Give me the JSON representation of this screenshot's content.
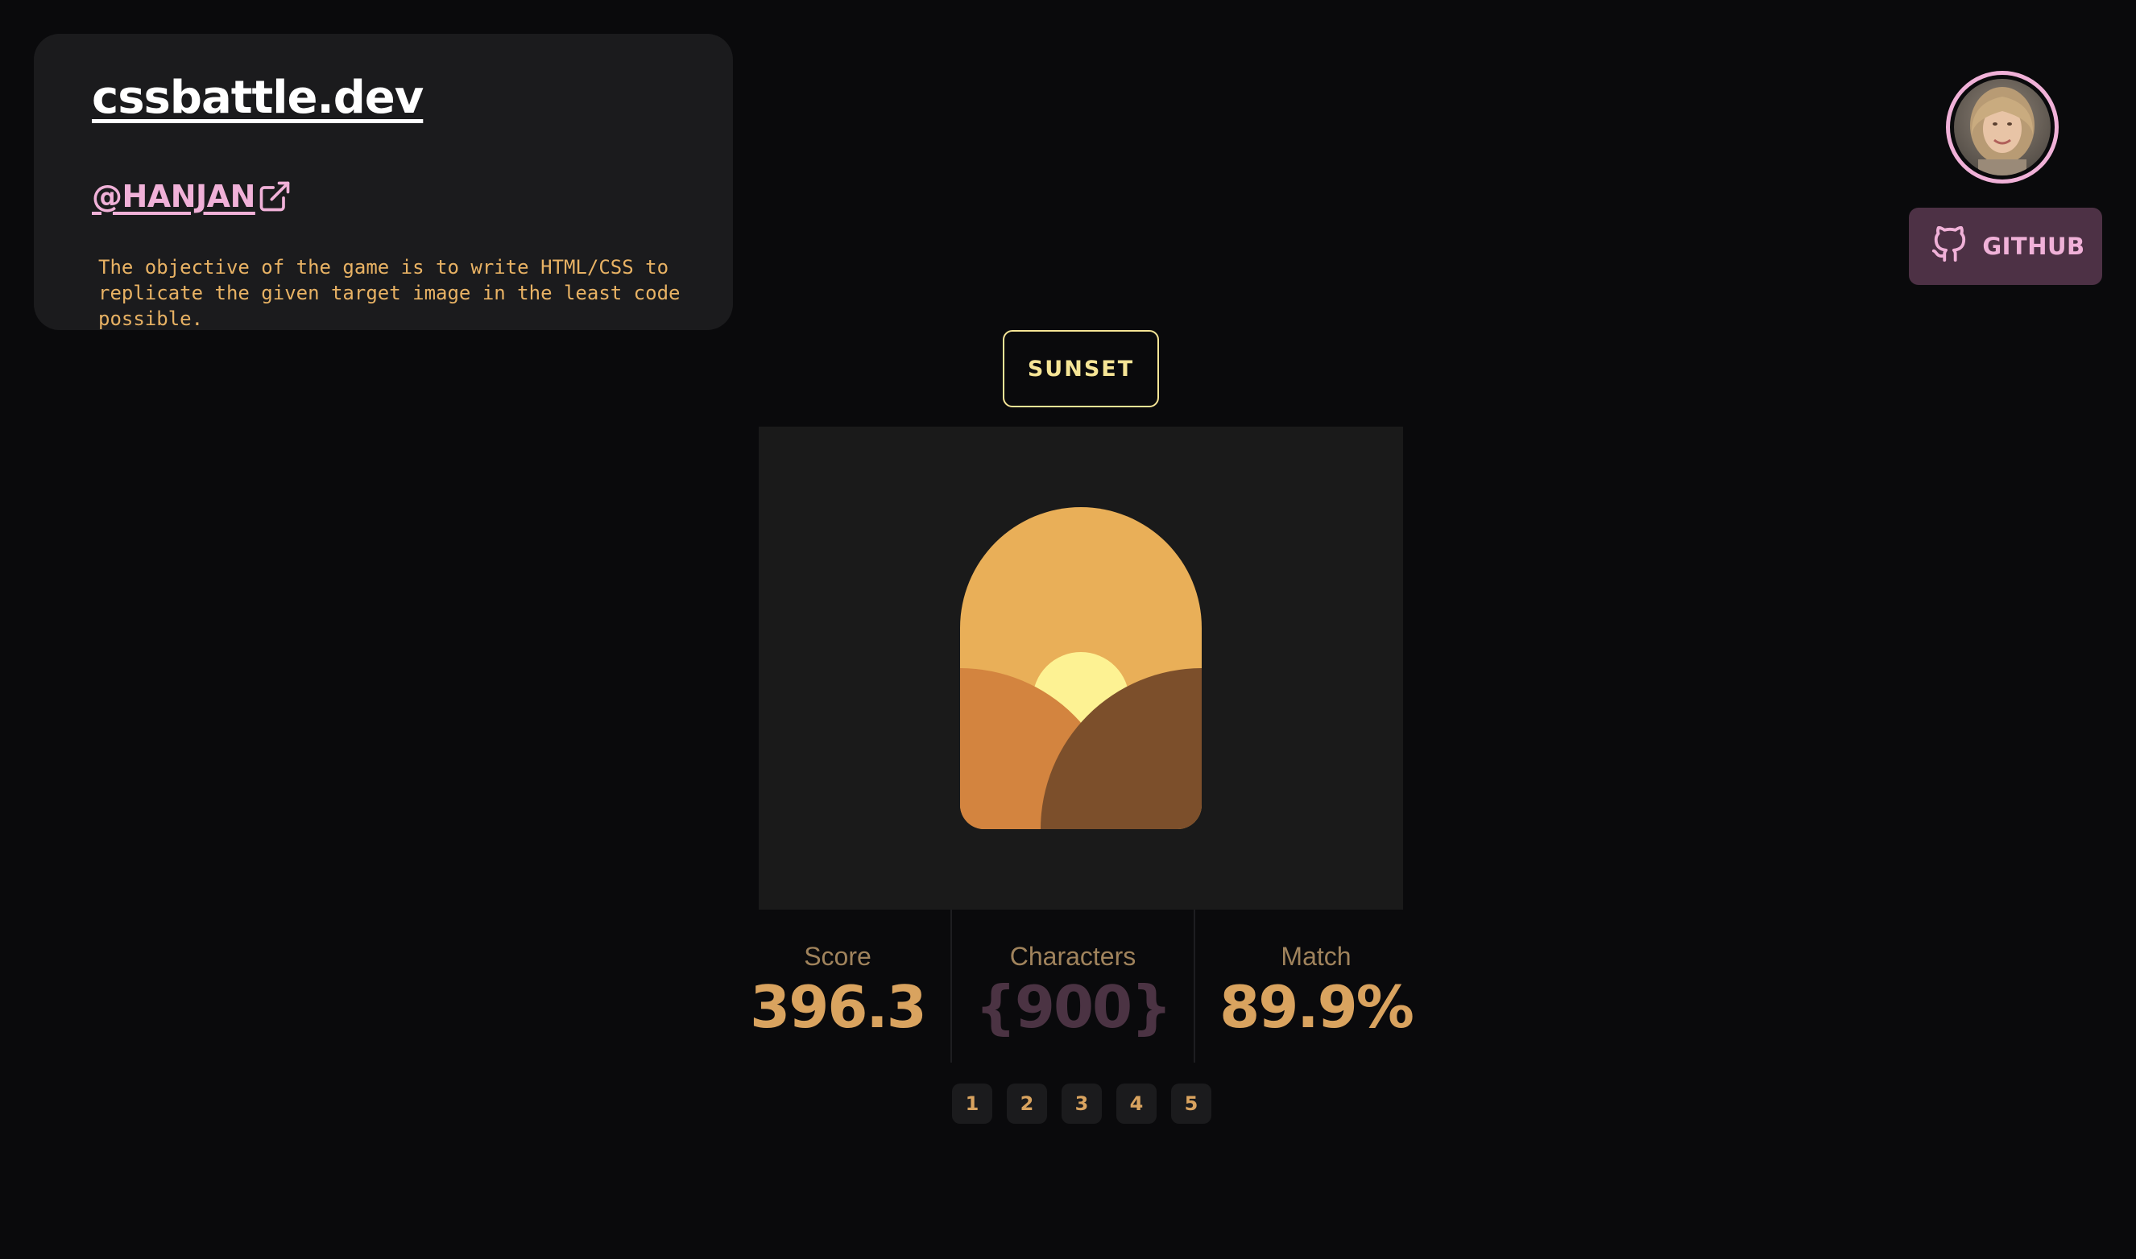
{
  "header": {
    "site_title": "cssbattle.dev",
    "username": "@HANJAN",
    "description": "The objective of the game is to write HTML/CSS to replicate the given target image in the least code possible."
  },
  "profile": {
    "avatar_icon": "avatar-photo",
    "github_label": "GITHUB",
    "github_icon": "github-icon"
  },
  "target": {
    "title": "SUNSET",
    "colors": {
      "background": "#1a1a1a",
      "sky": "#e9af58",
      "sun": "#fdf293",
      "left_hill": "#d3843f",
      "right_hill": "#7c4f2b"
    }
  },
  "stats": {
    "score_label": "Score",
    "score_value": "396.3",
    "characters_label": "Characters",
    "characters_value": "{900}",
    "match_label": "Match",
    "match_value": "89.9%"
  },
  "pagination": {
    "pages": [
      "1",
      "2",
      "3",
      "4",
      "5"
    ]
  },
  "colors": {
    "page_background": "#0a0a0c",
    "card_background": "#1b1b1d",
    "accent_pink": "#f0b1d8",
    "accent_yellow": "#f6e596",
    "accent_orange": "#e8b264",
    "github_button": "#4d3145"
  }
}
